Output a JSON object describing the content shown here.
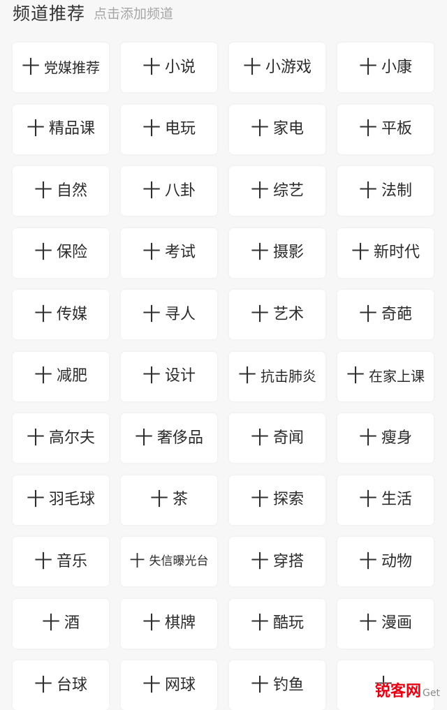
{
  "header": {
    "title": "频道推荐",
    "hint": "点击添加频道"
  },
  "plus_symbol": "十",
  "channels": [
    "党媒推荐",
    "小说",
    "小游戏",
    "小康",
    "精品课",
    "电玩",
    "家电",
    "平板",
    "自然",
    "八卦",
    "综艺",
    "法制",
    "保险",
    "考试",
    "摄影",
    "新时代",
    "传媒",
    "寻人",
    "艺术",
    "奇葩",
    "减肥",
    "设计",
    "抗击肺炎",
    "在家上课",
    "高尔夫",
    "奢侈品",
    "奇闻",
    "瘦身",
    "羽毛球",
    "茶",
    "探索",
    "生活",
    "音乐",
    "失信曝光台",
    "穿搭",
    "动物",
    "酒",
    "棋牌",
    "酷玩",
    "漫画",
    "台球",
    "网球",
    "钓鱼",
    ""
  ],
  "watermark": {
    "main": "锐客网",
    "sub": "Get"
  }
}
